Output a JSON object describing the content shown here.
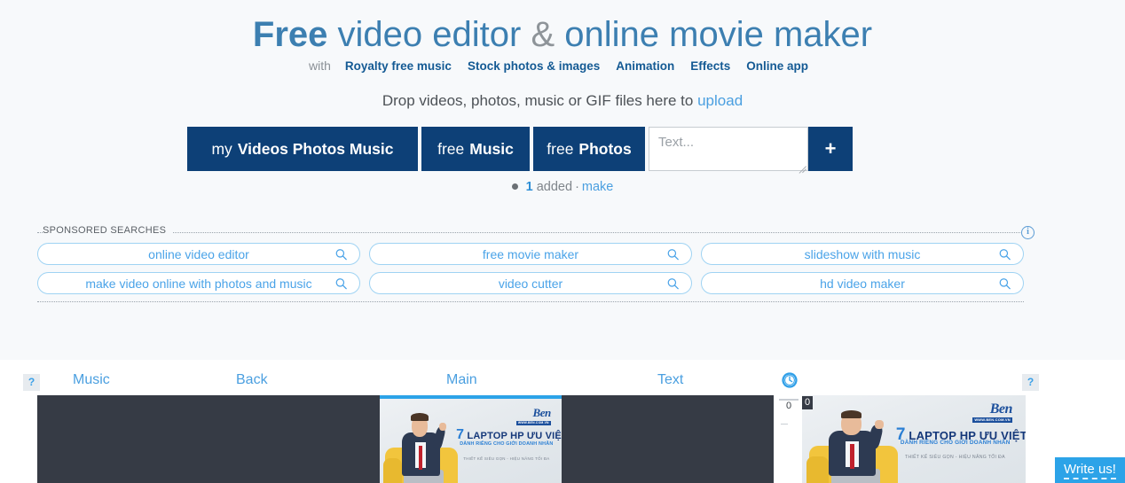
{
  "hero": {
    "title": {
      "part1": "Free",
      "part2": " video editor ",
      "amp": "&",
      "part3": " online movie maker"
    },
    "subnav": {
      "with_label": "with",
      "links": [
        {
          "label": "Royalty free music"
        },
        {
          "label": "Stock photos & images"
        },
        {
          "label": "Animation"
        },
        {
          "label": "Effects"
        },
        {
          "label": "Online app"
        }
      ]
    },
    "drop": {
      "text": "Drop videos, photos, music or GIF files here to ",
      "upload_link": "upload"
    }
  },
  "tabbar": {
    "my_button": {
      "lead": "my",
      "bold": "Videos Photos Music"
    },
    "music_button": {
      "lead": "free",
      "bold": "Music"
    },
    "photos_button": {
      "lead": "free",
      "bold": "Photos"
    },
    "text_input": {
      "placeholder": "Text...",
      "value": ""
    },
    "plus_button": "+"
  },
  "status": {
    "count": "1",
    "added_label": "added",
    "separator": "·",
    "make_link": "make"
  },
  "sponsored": {
    "legend": "SPONSORED SEARCHES",
    "info_icon": "i",
    "row1": [
      {
        "label": "online video editor",
        "icon": "search-icon"
      },
      {
        "label": "free movie maker",
        "icon": "search-icon"
      },
      {
        "label": "slideshow with music",
        "icon": "search-icon"
      }
    ],
    "row2": [
      {
        "label": "make video online with photos and music",
        "icon": "search-icon"
      },
      {
        "label": "video cutter",
        "icon": "search-icon"
      },
      {
        "label": "hd video maker",
        "icon": "search-icon"
      }
    ]
  },
  "editor": {
    "help_left": "?",
    "help_right": "?",
    "tabs": [
      {
        "label": "Music"
      },
      {
        "label": "Back"
      },
      {
        "label": "Main"
      },
      {
        "label": "Text"
      }
    ],
    "timer_icon": "clock-icon",
    "scale_zero": "0",
    "preview_zero": "0",
    "ad": {
      "brand": "Ben",
      "brand_sub": "WWW.BEN.COM.VN",
      "headline_number": "7",
      "headline": "LAPTOP HP ƯU VIỆT",
      "subline": "DÀNH RIÊNG CHO GIỚI DOANH NHÂN",
      "tagline": "THIẾT KẾ SIÊU GỌN - HIỆU NĂNG TỐI ĐA"
    }
  },
  "write_us": {
    "label": "Write us!"
  },
  "colors": {
    "brand_navy": "#0d4077",
    "accent_blue": "#4a9fe0",
    "title_blue": "#3c7fb1",
    "timeline_dark": "#363b45",
    "pill_border": "#9fd3f3",
    "hero_bg": "#f7f9fb"
  }
}
